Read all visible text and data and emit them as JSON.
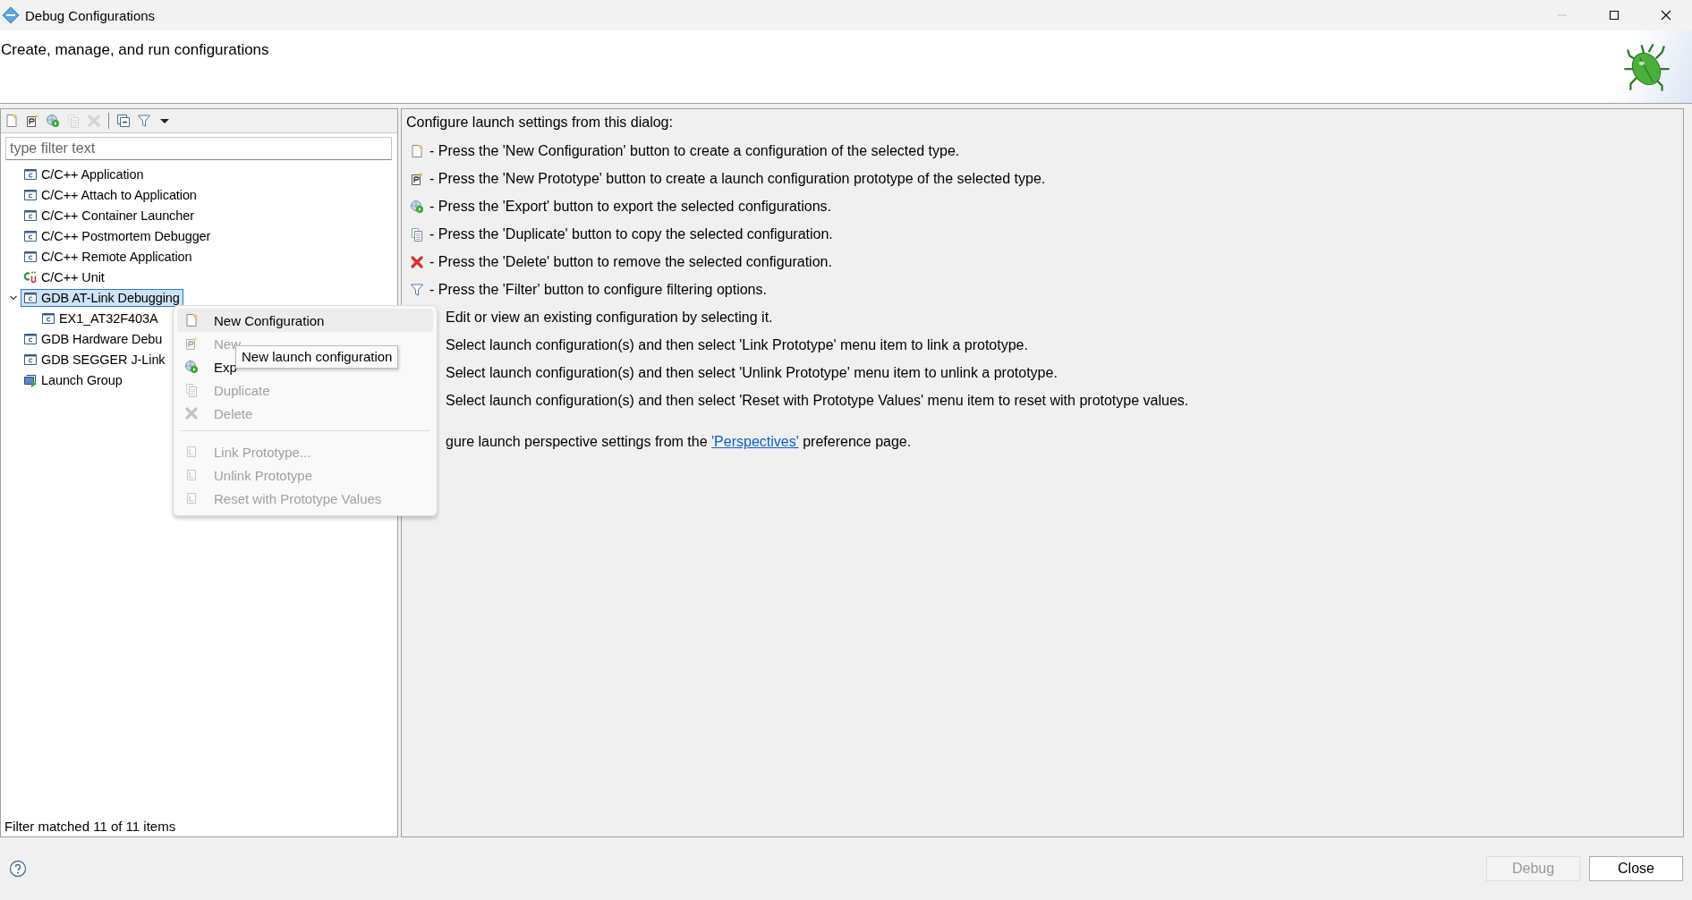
{
  "window": {
    "title": "Debug Configurations",
    "controls": [
      {
        "kind": "minimize",
        "disabled": true
      },
      {
        "kind": "maximize",
        "disabled": false
      },
      {
        "kind": "close",
        "disabled": false
      }
    ]
  },
  "header": {
    "title": "Create, manage, and run configurations"
  },
  "toolbar": [
    {
      "kind": "new",
      "disabled": false
    },
    {
      "kind": "prototype",
      "disabled": false
    },
    {
      "kind": "export",
      "disabled": false
    },
    {
      "kind": "duplicate",
      "disabled": true
    },
    {
      "kind": "delete",
      "disabled": true
    },
    {
      "kind": "separator"
    },
    {
      "kind": "collapse",
      "disabled": false
    },
    {
      "kind": "filter",
      "disabled": false
    },
    {
      "kind": "dropdown",
      "disabled": false
    }
  ],
  "filter": {
    "placeholder": "type filter text"
  },
  "tree": [
    {
      "label": "C/C++ Application",
      "kind": "c",
      "selected": false
    },
    {
      "label": "C/C++ Attach to Application",
      "kind": "c",
      "selected": false
    },
    {
      "label": "C/C++ Container Launcher",
      "kind": "c",
      "selected": false
    },
    {
      "label": "C/C++ Postmortem Debugger",
      "kind": "c",
      "selected": false
    },
    {
      "label": "C/C++ Remote Application",
      "kind": "c",
      "selected": false
    },
    {
      "label": "C/C++ Unit",
      "kind": "unit",
      "selected": false
    },
    {
      "label": "GDB AT-Link Debugging",
      "kind": "c",
      "selected": true,
      "expanded": true,
      "children": [
        {
          "label": "EX1_AT32F403A",
          "kind": "c",
          "selected": false
        }
      ]
    },
    {
      "label": "GDB Hardware Debu",
      "kind": "c",
      "selected": false
    },
    {
      "label": "GDB SEGGER J-Link",
      "kind": "c",
      "selected": false
    },
    {
      "label": "Launch Group",
      "kind": "group",
      "selected": false
    }
  ],
  "status": "Filter matched 11 of 11 items",
  "help": {
    "intro": "Configure launch settings from this dialog:",
    "items": [
      {
        "kind": "new",
        "text": "- Press the 'New Configuration' button to create a configuration of the selected type."
      },
      {
        "kind": "prototype",
        "text": "- Press the 'New Prototype' button to create a launch configuration prototype of the selected type."
      },
      {
        "kind": "export",
        "text": "- Press the 'Export' button to export the selected configurations."
      },
      {
        "kind": "duplicate",
        "text": "- Press the 'Duplicate' button to copy the selected configuration."
      },
      {
        "kind": "delete",
        "text": "- Press the 'Delete' button to remove the selected configuration."
      },
      {
        "kind": "filter",
        "text": "- Press the 'Filter' button to configure filtering options."
      },
      {
        "kind": "hidden",
        "text": "Edit or view an existing configuration by selecting it."
      },
      {
        "kind": "hidden",
        "text": "Select launch configuration(s) and then select 'Link Prototype' menu item to link a prototype."
      },
      {
        "kind": "hidden",
        "text": "Select launch configuration(s) and then select 'Unlink Prototype' menu item to unlink a prototype."
      },
      {
        "kind": "hidden",
        "text": "Select launch configuration(s) and then select 'Reset with Prototype Values' menu item to reset with prototype values."
      }
    ],
    "footer": {
      "before": "gure launch perspective settings from the",
      "link": "'Perspectives'",
      "after": "preference page."
    }
  },
  "context_menu": [
    {
      "kind": "new",
      "label": "New Configuration",
      "disabled": false,
      "highlighted": true
    },
    {
      "kind": "prototype",
      "label": "New",
      "disabled": true,
      "highlighted": false
    },
    {
      "kind": "export",
      "label": "Exp",
      "disabled": false,
      "highlighted": false
    },
    {
      "kind": "duplicate",
      "label": "Duplicate",
      "disabled": true,
      "highlighted": false
    },
    {
      "kind": "delete",
      "label": "Delete",
      "disabled": true,
      "highlighted": false
    },
    {
      "kind": "separator"
    },
    {
      "kind": "link",
      "label": "Link Prototype...",
      "disabled": true,
      "highlighted": false
    },
    {
      "kind": "unlink",
      "label": "Unlink Prototype",
      "disabled": true,
      "highlighted": false
    },
    {
      "kind": "reset",
      "label": "Reset with Prototype Values",
      "disabled": true,
      "highlighted": false
    }
  ],
  "tooltip": "New launch configuration",
  "buttons": [
    {
      "label": "Debug",
      "disabled": true
    },
    {
      "label": "Close",
      "disabled": false
    }
  ]
}
